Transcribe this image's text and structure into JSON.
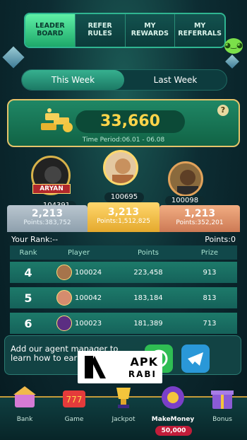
{
  "tabs": [
    {
      "label": "LEADER\nBOARD",
      "active": true
    },
    {
      "label": "REFER\nRULES",
      "active": false
    },
    {
      "label": "MY\nREWARDS",
      "active": false
    },
    {
      "label": "MY\nREFERRALS",
      "active": false
    }
  ],
  "week_toggle": {
    "this_week": "This Week",
    "last_week": "Last Week"
  },
  "prize_pool": {
    "amount": "33,660",
    "time_period": "Time Period:06.01 - 06.08",
    "help": "?"
  },
  "podium": {
    "first": {
      "name_tag": "ARYAN",
      "id": "100695",
      "score": "3,213",
      "points": "Points:1,512,825"
    },
    "second": {
      "id": "104391",
      "score": "2,213",
      "points": "Points:383,752"
    },
    "third": {
      "id": "100098",
      "score": "1,213",
      "points": "Points:352,201"
    }
  },
  "your_rank": {
    "label": "Your Rank:--",
    "points": "Points:0"
  },
  "table": {
    "headers": {
      "rank": "Rank",
      "player": "Player",
      "points": "Points",
      "prize": "Prize"
    },
    "rows": [
      {
        "rank": "4",
        "player": "100024",
        "points": "223,458",
        "prize": "913"
      },
      {
        "rank": "5",
        "player": "100042",
        "points": "183,184",
        "prize": "813"
      },
      {
        "rank": "6",
        "player": "100023",
        "points": "181,389",
        "prize": "713"
      }
    ]
  },
  "agent": {
    "text": "Add our agent manager to learn how to earn much"
  },
  "watermark": {
    "line1": "APK",
    "line2": "RABI"
  },
  "nav": [
    {
      "label": "Bank",
      "icon": "bank-icon"
    },
    {
      "label": "Game",
      "icon": "slot-777-icon"
    },
    {
      "label": "Jackpot",
      "icon": "jackpot-trophy-icon"
    },
    {
      "label": "MakeMoney",
      "icon": "make-money-icon"
    },
    {
      "label": "Bonus",
      "icon": "gift-box-icon"
    }
  ],
  "coin_badge": "50,000",
  "colors": {
    "accent": "#2fb591",
    "gold": "#ffd54a",
    "panel": "#1f8765"
  }
}
